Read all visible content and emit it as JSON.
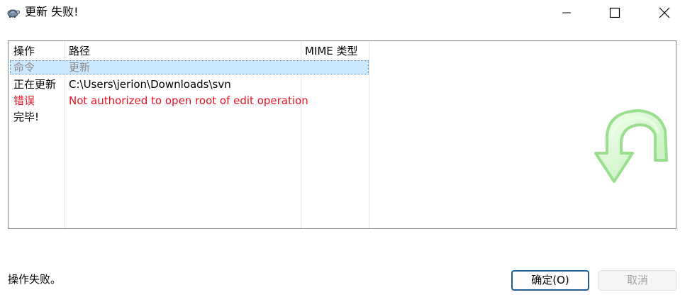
{
  "window": {
    "title": "更新 失败!",
    "app_icon": "tortoise-icon"
  },
  "list": {
    "columns": [
      "操作",
      "路径",
      "MIME 类型"
    ],
    "rows": [
      {
        "action": "命令",
        "path": "更新",
        "selected": true
      },
      {
        "action": "正在更新",
        "path": "C:\\Users\\jerion\\Downloads\\svn"
      },
      {
        "action": "错误",
        "path": "Not authorized to open root of edit operation",
        "status": "error"
      },
      {
        "action": "完毕!",
        "path": ""
      }
    ]
  },
  "animation_icon": "green-update-arrow-icon",
  "status_text": "操作失败。",
  "buttons": {
    "ok": "确定(O)",
    "cancel": "取消"
  },
  "colors": {
    "error": "#e81123",
    "selection": "#cce8ff",
    "accent": "#1f5c92"
  }
}
